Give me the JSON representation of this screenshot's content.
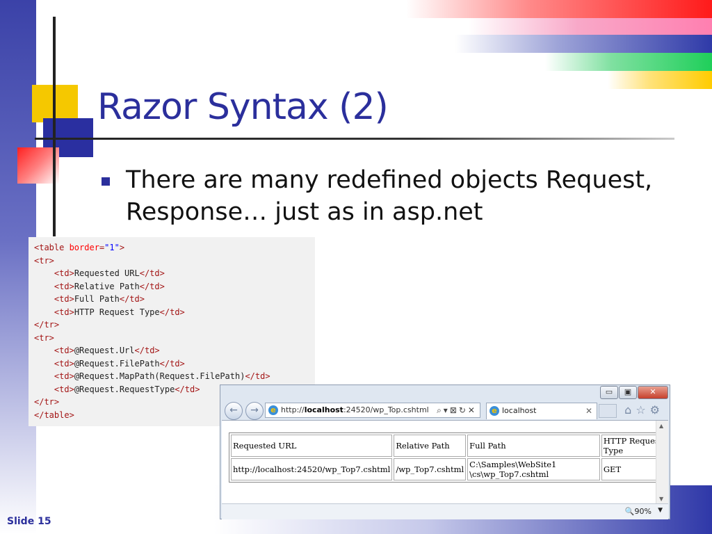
{
  "slide": {
    "title": "Razor Syntax (2)",
    "bullet": "There are many redefined objects Request, Response… just as in asp.net",
    "slide_number": "Slide 15"
  },
  "code_lines": [
    [
      {
        "t": "<table ",
        "c": "tag"
      },
      {
        "t": "border",
        "c": "attr"
      },
      {
        "t": "=",
        "c": "tag"
      },
      {
        "t": "\"1\"",
        "c": "val"
      },
      {
        "t": ">",
        "c": "tag"
      }
    ],
    [
      {
        "t": "<tr>",
        "c": "tag"
      }
    ],
    [
      {
        "t": "    "
      },
      {
        "t": "<td>",
        "c": "tag"
      },
      {
        "t": "Requested URL"
      },
      {
        "t": "</td>",
        "c": "tag"
      }
    ],
    [
      {
        "t": "    "
      },
      {
        "t": "<td>",
        "c": "tag"
      },
      {
        "t": "Relative Path"
      },
      {
        "t": "</td>",
        "c": "tag"
      }
    ],
    [
      {
        "t": "    "
      },
      {
        "t": "<td>",
        "c": "tag"
      },
      {
        "t": "Full Path"
      },
      {
        "t": "</td>",
        "c": "tag"
      }
    ],
    [
      {
        "t": "    "
      },
      {
        "t": "<td>",
        "c": "tag"
      },
      {
        "t": "HTTP Request Type"
      },
      {
        "t": "</td>",
        "c": "tag"
      }
    ],
    [
      {
        "t": "</tr>",
        "c": "tag"
      }
    ],
    [
      {
        "t": "<tr>",
        "c": "tag"
      }
    ],
    [
      {
        "t": "    "
      },
      {
        "t": "<td>",
        "c": "tag"
      },
      {
        "t": "@Request.Url"
      },
      {
        "t": "</td>",
        "c": "tag"
      }
    ],
    [
      {
        "t": "    "
      },
      {
        "t": "<td>",
        "c": "tag"
      },
      {
        "t": "@Request.FilePath"
      },
      {
        "t": "</td>",
        "c": "tag"
      }
    ],
    [
      {
        "t": "    "
      },
      {
        "t": "<td>",
        "c": "tag"
      },
      {
        "t": "@Request.MapPath(Request.FilePath)"
      },
      {
        "t": "</td>",
        "c": "tag"
      }
    ],
    [
      {
        "t": "    "
      },
      {
        "t": "<td>",
        "c": "tag"
      },
      {
        "t": "@Request.RequestType"
      },
      {
        "t": "</td>",
        "c": "tag"
      }
    ],
    [
      {
        "t": "</tr>",
        "c": "tag"
      }
    ],
    [
      {
        "t": "</table>",
        "c": "tag"
      }
    ]
  ],
  "browser": {
    "url_prefix": "http://",
    "url_host": "localhost",
    "url_rest": ":24520/wp_Top.cshtml",
    "tab_title": "localhost",
    "zoom": "90%",
    "win_minimize": "▭",
    "win_maximize": "▣",
    "win_close": "✕",
    "back_icon": "←",
    "forward_icon": "→",
    "addr_tools": "⌕▾⊠↻✕",
    "tab_close": "✕",
    "right_tools": "⌂☆⚙",
    "zoom_icon": "🔍",
    "zoom_dropdown": "▼",
    "scroll_up": "▲",
    "scroll_down": "▼"
  },
  "result_table": {
    "headers": [
      "Requested URL",
      "Relative Path",
      "Full Path",
      "HTTP Request\nType"
    ],
    "row": [
      "http://localhost:24520/wp_Top7.cshtml",
      "/wp_Top7.cshtml",
      "C:\\Samples\\WebSite1\n\\cs\\wp_Top7.cshtml",
      "GET"
    ]
  },
  "colors": {
    "title": "#2b2f9c",
    "tag": "#a31515",
    "attr": "#ff0000",
    "value": "#0000ff"
  }
}
